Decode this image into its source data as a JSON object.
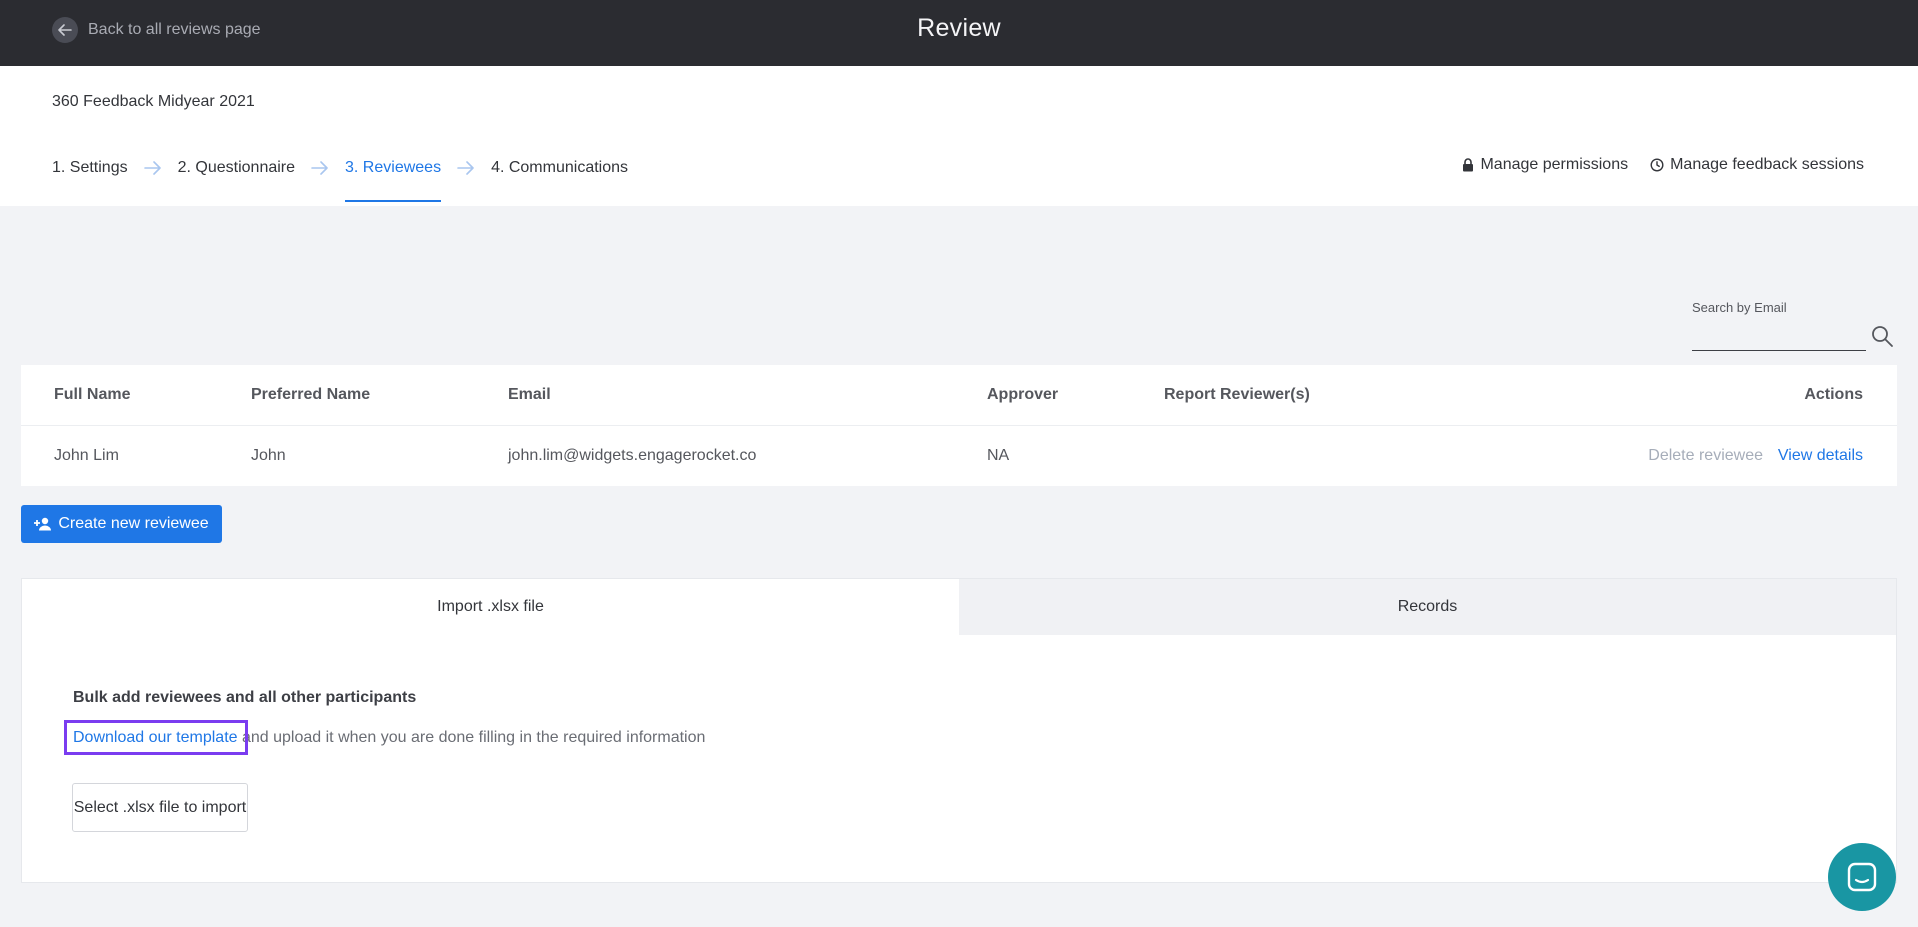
{
  "topbar": {
    "back_label": "Back to all reviews page",
    "title": "Review"
  },
  "header": {
    "review_name": "360 Feedback Midyear 2021",
    "steps": [
      {
        "label": "1. Settings"
      },
      {
        "label": "2. Questionnaire"
      },
      {
        "label": "3. Reviewees",
        "active": true
      },
      {
        "label": "4. Communications"
      }
    ],
    "actions": {
      "permissions": "Manage permissions",
      "sessions": "Manage feedback sessions"
    }
  },
  "search": {
    "label": "Search by Email",
    "value": ""
  },
  "table": {
    "columns": [
      "Full Name",
      "Preferred Name",
      "Email",
      "Approver",
      "Report Reviewer(s)",
      "Actions"
    ],
    "rows": [
      {
        "full_name": "John Lim",
        "preferred_name": "John",
        "email": "john.lim@widgets.engagerocket.co",
        "approver": "NA",
        "report_reviewers": "",
        "delete_label": "Delete reviewee",
        "view_label": "View details"
      }
    ]
  },
  "create_button": "Create new reviewee",
  "import_panel": {
    "tabs": [
      {
        "label": "Import .xlsx file",
        "active": true
      },
      {
        "label": "Records",
        "active": false
      }
    ],
    "bulk_title": "Bulk add reviewees and all other participants",
    "download_link": "Download our template",
    "download_suffix": " and upload it when you are done filling in the required information",
    "select_button": "Select .xlsx file to import"
  },
  "colors": {
    "accent": "#1f77e6",
    "topbar": "#2b2c31",
    "highlight": "#7a3cf0",
    "chat": "#1996a3"
  },
  "icons": [
    "back-arrow-icon",
    "step-arrow-icon",
    "lock-icon",
    "clock-icon",
    "search-icon",
    "add-user-icon",
    "chat-icon"
  ]
}
